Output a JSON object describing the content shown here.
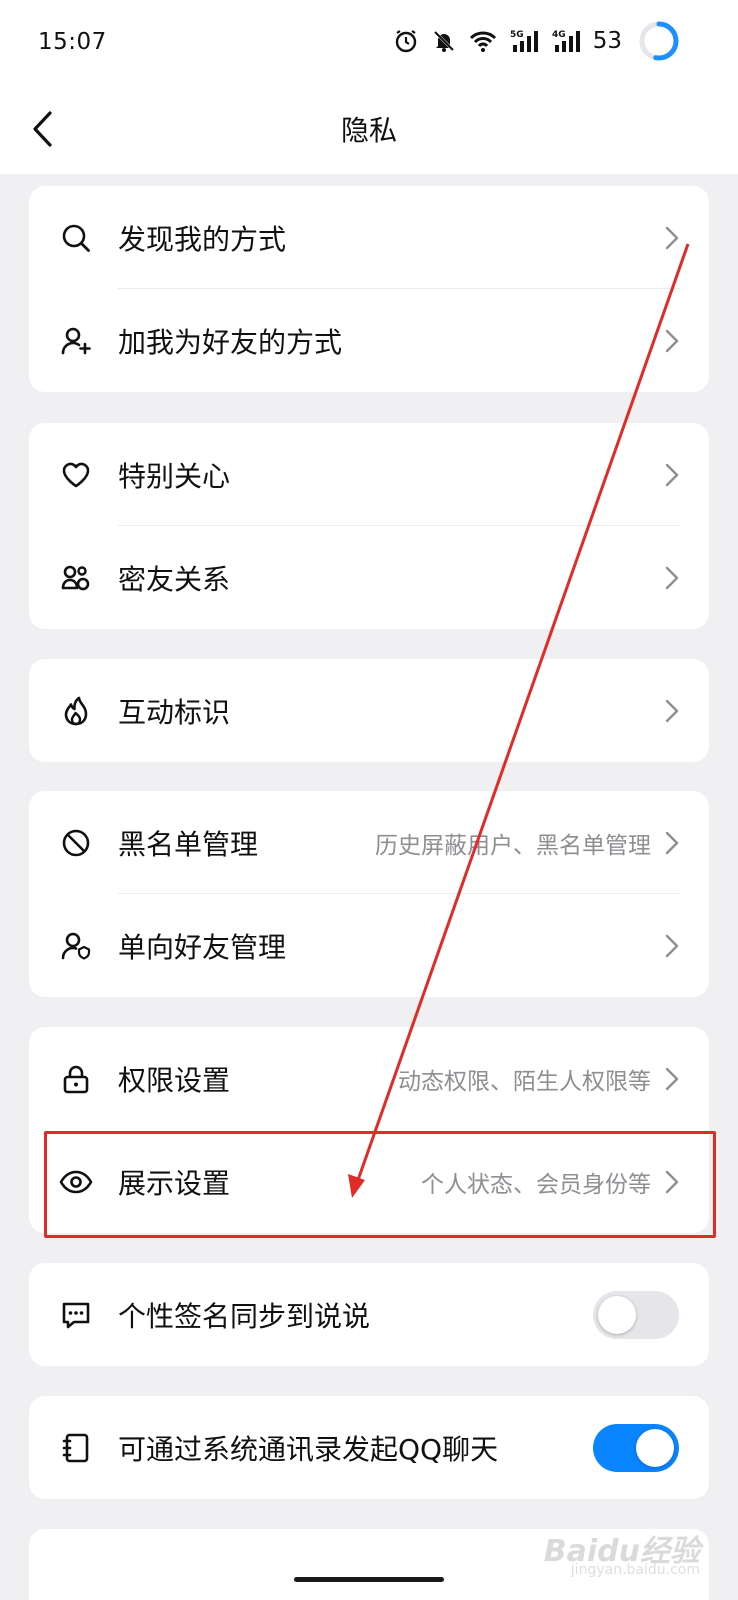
{
  "status_bar": {
    "time": "15:07",
    "battery": "53",
    "signal_5g": "5G",
    "signal_4g": "4G"
  },
  "header": {
    "title": "隐私"
  },
  "sections": [
    {
      "items": [
        {
          "label": "发现我的方式",
          "icon": "search-icon"
        },
        {
          "label": "加我为好友的方式",
          "icon": "add-friend-icon"
        }
      ]
    },
    {
      "items": [
        {
          "label": "特别关心",
          "icon": "heart-icon"
        },
        {
          "label": "密友关系",
          "icon": "close-friends-icon"
        }
      ]
    },
    {
      "items": [
        {
          "label": "互动标识",
          "icon": "flame-icon"
        }
      ]
    },
    {
      "items": [
        {
          "label": "黑名单管理",
          "sub": "历史屏蔽用户、黑名单管理",
          "icon": "block-icon"
        },
        {
          "label": "单向好友管理",
          "icon": "user-shield-icon"
        }
      ]
    },
    {
      "items": [
        {
          "label": "权限设置",
          "sub": "动态权限、陌生人权限等",
          "icon": "lock-icon"
        },
        {
          "label": "展示设置",
          "sub": "个人状态、会员身份等",
          "icon": "eye-icon"
        }
      ]
    },
    {
      "items": [
        {
          "label": "个性签名同步到说说",
          "icon": "message-icon",
          "toggle": false
        }
      ]
    },
    {
      "items": [
        {
          "label": "可通过系统通讯录发起QQ聊天",
          "icon": "contacts-book-icon",
          "toggle": true
        }
      ]
    }
  ],
  "watermark": {
    "main": "Baidu经验",
    "sub": "jingyan.baidu.com"
  },
  "colors": {
    "background": "#f0f0f2",
    "accent": "#0a84ff",
    "annotation": "#e02b27"
  }
}
